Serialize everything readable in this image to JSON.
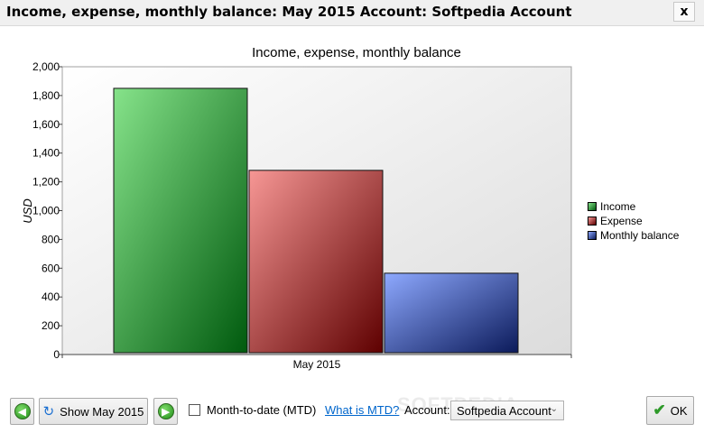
{
  "window": {
    "title": "Income, expense, monthly balance: May 2015   Account: Softpedia Account",
    "close_label": "x"
  },
  "chart_data": {
    "type": "bar",
    "title": "Income, expense, monthly balance",
    "ylabel": "USD",
    "xlabel": "",
    "categories": [
      "May 2015"
    ],
    "series": [
      {
        "name": "Income",
        "values": [
          1850
        ],
        "color_light": "#86e38a",
        "color_dark": "#005a0e"
      },
      {
        "name": "Expense",
        "values": [
          1280
        ],
        "color_light": "#f79795",
        "color_dark": "#5e0000"
      },
      {
        "name": "Monthly balance",
        "values": [
          565
        ],
        "color_light": "#8ea9ff",
        "color_dark": "#0b1a5a"
      }
    ],
    "ylim": [
      0,
      2000
    ],
    "yticks": [
      "0",
      "200",
      "400",
      "600",
      "800",
      "1,000",
      "1,200",
      "1,400",
      "1,600",
      "1,800",
      "2,000"
    ],
    "legend": "right"
  },
  "toolbar": {
    "prev_icon": "arrow-left-icon",
    "show_label": "Show May 2015",
    "next_icon": "arrow-right-icon",
    "mtd_label": "Month-to-date (MTD)",
    "mtd_checked": false,
    "mtd_link": "What is MTD?",
    "account_label": "Account:",
    "account_value": "Softpedia Account",
    "ok_label": "OK"
  }
}
